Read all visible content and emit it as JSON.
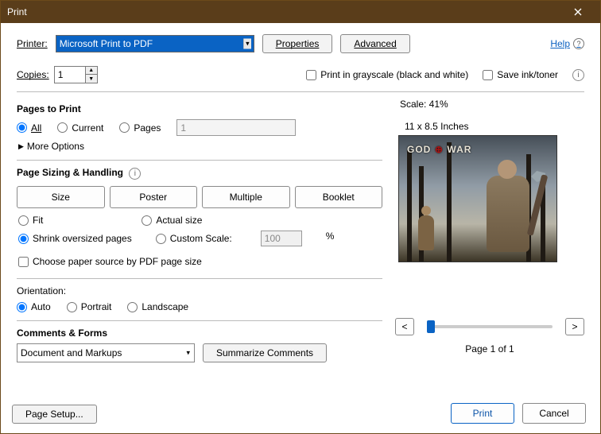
{
  "window": {
    "title": "Print"
  },
  "header": {
    "printer_label": "Printer:",
    "printer_value": "Microsoft Print to PDF",
    "properties": "Properties",
    "advanced": "Advanced",
    "help": "Help"
  },
  "copies": {
    "label": "Copies:",
    "value": "1",
    "grayscale": "Print in grayscale (black and white)",
    "save_ink": "Save ink/toner"
  },
  "pages": {
    "title": "Pages to Print",
    "all": "All",
    "current": "Current",
    "pages": "Pages",
    "pages_value": "1",
    "more": "More Options"
  },
  "sizing": {
    "title": "Page Sizing & Handling",
    "size": "Size",
    "poster": "Poster",
    "multiple": "Multiple",
    "booklet": "Booklet",
    "fit": "Fit",
    "actual": "Actual size",
    "shrink": "Shrink oversized pages",
    "custom": "Custom Scale:",
    "custom_value": "100",
    "percent": "%",
    "choose_paper": "Choose paper source by PDF page size"
  },
  "orientation": {
    "title": "Orientation:",
    "auto": "Auto",
    "portrait": "Portrait",
    "landscape": "Landscape"
  },
  "comments": {
    "title": "Comments & Forms",
    "selected": "Document and Markups",
    "summarize": "Summarize Comments"
  },
  "preview": {
    "scale": "Scale:  41%",
    "paper": "11 x 8.5 Inches",
    "logo_a": "GOD",
    "logo_b": "WAR",
    "page": "Page 1 of 1",
    "prev": "<",
    "next": ">"
  },
  "footer": {
    "page_setup": "Page Setup...",
    "print": "Print",
    "cancel": "Cancel"
  }
}
